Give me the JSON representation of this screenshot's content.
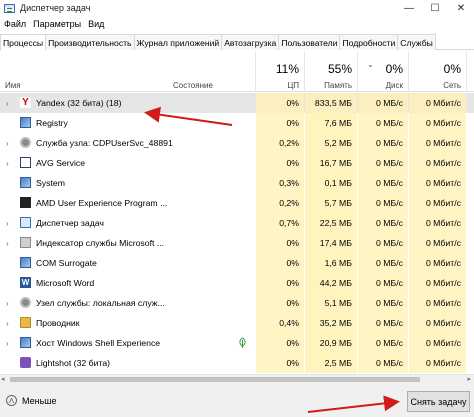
{
  "window": {
    "title": "Диспетчер задач",
    "minimize": "—",
    "maximize": "☐",
    "close": "✕"
  },
  "menu": [
    "Файл",
    "Параметры",
    "Вид"
  ],
  "tabs": [
    {
      "label": "Процессы",
      "active": true
    },
    {
      "label": "Производительность",
      "active": false
    },
    {
      "label": "Журнал приложений",
      "active": false
    },
    {
      "label": "Автозагрузка",
      "active": false
    },
    {
      "label": "Пользователи",
      "active": false
    },
    {
      "label": "Подробности",
      "active": false
    },
    {
      "label": "Службы",
      "active": false
    }
  ],
  "columns": {
    "name": "Имя",
    "status": "Состояние",
    "cpu": {
      "pct": "11%",
      "label": "ЦП"
    },
    "memory": {
      "pct": "55%",
      "label": "Память"
    },
    "disk": {
      "pct": "0%",
      "label": "Диск"
    },
    "network": {
      "pct": "0%",
      "label": "Сеть"
    },
    "sort_indicator": "⌄"
  },
  "processes": [
    {
      "name": "Yandex (32 бита) (18)",
      "icon": "yandex-icon",
      "expandable": true,
      "cpu": "0%",
      "memory": "833,5 МБ",
      "disk": "0 МБ/с",
      "network": "0 Мбит/с",
      "selected": true
    },
    {
      "name": "Registry",
      "icon": "process-icon",
      "expandable": false,
      "cpu": "0%",
      "memory": "7,6 МБ",
      "disk": "0 МБ/с",
      "network": "0 Мбит/с"
    },
    {
      "name": "Служба узла: CDPUserSvc_48891",
      "icon": "gear-icon",
      "expandable": true,
      "cpu": "0,2%",
      "memory": "5,2 МБ",
      "disk": "0 МБ/с",
      "network": "0 Мбит/с"
    },
    {
      "name": "AVG Service",
      "icon": "avg-icon",
      "expandable": true,
      "cpu": "0%",
      "memory": "16,7 МБ",
      "disk": "0 МБ/с",
      "network": "0 Мбит/с"
    },
    {
      "name": "System",
      "icon": "process-icon",
      "expandable": false,
      "cpu": "0,3%",
      "memory": "0,1 МБ",
      "disk": "0 МБ/с",
      "network": "0 Мбит/с"
    },
    {
      "name": "AMD User Experience Program ...",
      "icon": "amd-icon",
      "expandable": false,
      "cpu": "0,2%",
      "memory": "5,7 МБ",
      "disk": "0 МБ/с",
      "network": "0 Мбит/с"
    },
    {
      "name": "Диспетчер задач",
      "icon": "task-manager-icon",
      "expandable": true,
      "cpu": "0,7%",
      "memory": "22,5 МБ",
      "disk": "0 МБ/с",
      "network": "0 Мбит/с"
    },
    {
      "name": "Индексатор службы Microsoft ...",
      "icon": "search-indexer-icon",
      "expandable": true,
      "cpu": "0%",
      "memory": "17,4 МБ",
      "disk": "0 МБ/с",
      "network": "0 Мбит/с"
    },
    {
      "name": "COM Surrogate",
      "icon": "process-icon",
      "expandable": false,
      "cpu": "0%",
      "memory": "1,6 МБ",
      "disk": "0 МБ/с",
      "network": "0 Мбит/с"
    },
    {
      "name": "Microsoft Word",
      "icon": "word-icon",
      "expandable": false,
      "cpu": "0%",
      "memory": "44,2 МБ",
      "disk": "0 МБ/с",
      "network": "0 Мбит/с"
    },
    {
      "name": "Узел службы: локальная служ...",
      "icon": "gear-icon",
      "expandable": true,
      "cpu": "0%",
      "memory": "5,1 МБ",
      "disk": "0 МБ/с",
      "network": "0 Мбит/с"
    },
    {
      "name": "Проводник",
      "icon": "folder-icon",
      "expandable": true,
      "cpu": "0,4%",
      "memory": "35,2 МБ",
      "disk": "0 МБ/с",
      "network": "0 Мбит/с"
    },
    {
      "name": "Хост Windows Shell Experience",
      "icon": "process-icon",
      "expandable": true,
      "cpu": "0%",
      "memory": "20,9 МБ",
      "disk": "0 МБ/с",
      "network": "0 Мбит/с",
      "suspended_leaf": true
    },
    {
      "name": "Lightshot (32 бита)",
      "icon": "lightshot-icon",
      "expandable": false,
      "cpu": "0%",
      "memory": "2,5 МБ",
      "disk": "0 МБ/с",
      "network": "0 Мбит/с"
    }
  ],
  "footer": {
    "fewer_label": "Меньше",
    "fewer_icon": "ᐱ",
    "end_task_label": "Снять задачу"
  },
  "colors": {
    "cell_highlight": "#fff4c4",
    "selected_row": "#e5e5e5",
    "annotation_arrow": "#d11a1a"
  }
}
